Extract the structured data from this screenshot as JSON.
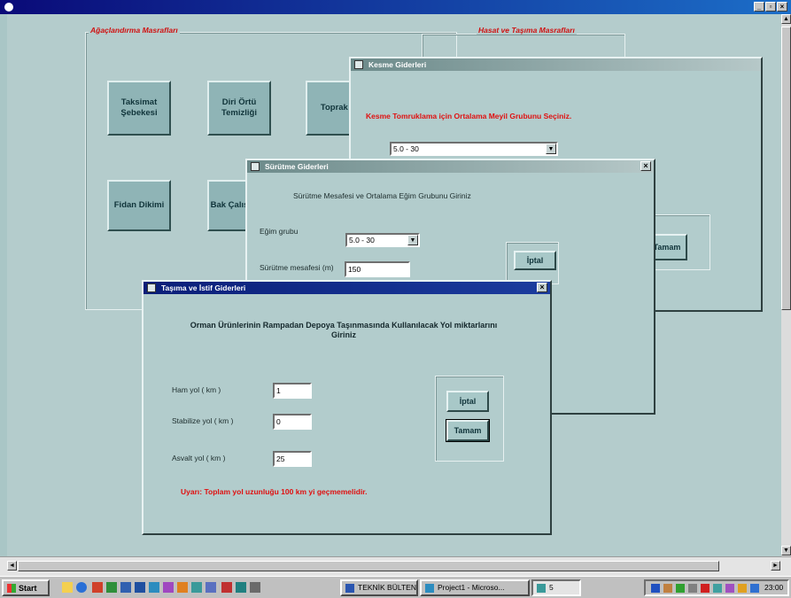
{
  "main_window": {
    "title": ""
  },
  "main_form": {
    "frame_left_caption": "Ağaçlandırma Masrafları",
    "frame_right_caption": "Hasat ve Taşıma Masrafları",
    "buttons": {
      "taksimat": "Taksimat Şebekesi",
      "diri_ortu": "Diri Örtü Temizliği",
      "toprak": "Toprak İ",
      "fidan": "Fidan Dikimi",
      "bakim": "Bak Çalış"
    }
  },
  "kesme_window": {
    "title": "Kesme Giderleri",
    "prompt": "Kesme Tomruklama için Ortalama Meyil Grubunu Seçiniz.",
    "combo_value": "5.0 - 30",
    "tamam_label": "Tamam"
  },
  "surutme_window": {
    "title": "Sürütme Giderleri",
    "prompt": "Sürütme Mesafesi ve Ortalama Eğim Grubunu Giriniz",
    "egim_label": "Eğim grubu",
    "egim_value": "5.0 - 30",
    "mesafe_label": "Sürütme mesafesi (m)",
    "mesafe_value": "150",
    "iptal_label": "İptal"
  },
  "tasima_window": {
    "title": "Taşıma ve İstif Giderleri",
    "prompt": "Orman Ürünlerinin  Rampadan Depoya Taşınmasında Kullanılacak Yol miktarlarını Giriniz",
    "fields": [
      {
        "label": "Ham yol ( km )",
        "value": "1"
      },
      {
        "label": "Stabilize yol ( km )",
        "value": "0"
      },
      {
        "label": "Asvalt yol ( km )",
        "value": "25"
      }
    ],
    "iptal_label": "İptal",
    "tamam_label": "Tamam",
    "warning": "Uyarı: Toplam yol uzunluğu 100 km yi geçmemelidir."
  },
  "taskbar": {
    "start_label": "Start",
    "tasks": [
      {
        "label": "TEKNİK BÜLTEN..."
      },
      {
        "label": "Project1 - Microso..."
      },
      {
        "label": "5"
      }
    ],
    "clock": "23:00"
  },
  "colors": {
    "client_background": "#b4cccc",
    "window_background": "#b2cccc",
    "button_face": "#8fb4b6",
    "warning_red": "#e01010",
    "active_title": "#0a1e78"
  }
}
